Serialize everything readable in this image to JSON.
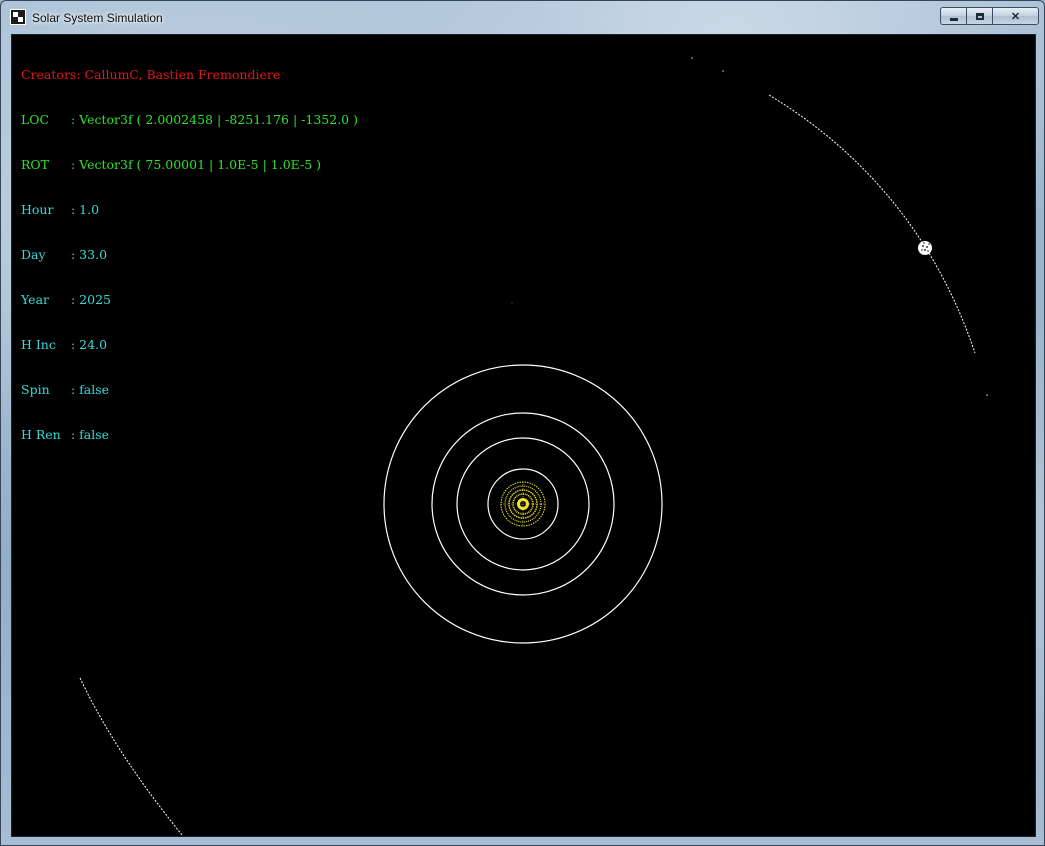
{
  "window": {
    "title": "Solar System Simulation",
    "controls": {
      "minimize": "minimize",
      "maximize": "maximize",
      "close": "✕"
    }
  },
  "hud": {
    "creators": "Creators: CallumC, Bastien Fremondiere",
    "rows": [
      {
        "key": "LOC",
        "value": ": Vector3f ( 2.0002458 | -8251.176 | -1352.0 )",
        "color": "#2fe12f"
      },
      {
        "key": "ROT",
        "value": ": Vector3f ( 75.00001 | 1.0E-5 | 1.0E-5 )",
        "color": "#2fe12f"
      },
      {
        "key": "Hour",
        "value": ": 1.0",
        "color": "#38d9d9"
      },
      {
        "key": "Day",
        "value": ": 33.0",
        "color": "#38d9d9"
      },
      {
        "key": "Year",
        "value": ": 2025",
        "color": "#38d9d9"
      },
      {
        "key": "H Inc",
        "value": ": 24.0",
        "color": "#38d9d9"
      },
      {
        "key": "Spin",
        "value": ": false",
        "color": "#38d9d9"
      },
      {
        "key": "H Ren",
        "value": ": false",
        "color": "#38d9d9"
      }
    ]
  },
  "scene": {
    "background": "#000000",
    "sun_color": "#f0e22a",
    "orbit_color": "#ffffff",
    "inner_orbit_count": 4,
    "planet_color": "#ffffff"
  }
}
